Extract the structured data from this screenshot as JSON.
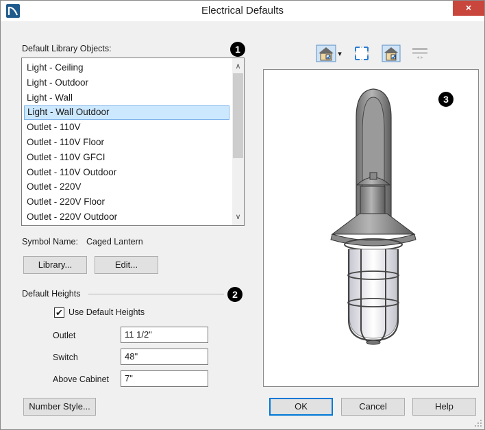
{
  "window": {
    "title": "Electrical Defaults",
    "close_label": "×",
    "app_icon": "chief-architect-logo-icon"
  },
  "library": {
    "label": "Default Library Objects:",
    "items": [
      "Light - Ceiling",
      "Light - Outdoor",
      "Light - Wall",
      "Light - Wall Outdoor",
      "Outlet - 110V",
      "Outlet - 110V Floor",
      "Outlet - 110V GFCI",
      "Outlet - 110V Outdoor",
      "Outlet - 220V",
      "Outlet - 220V Floor",
      "Outlet - 220V Outdoor"
    ],
    "selected_index": 3,
    "scroll_up": "∧",
    "scroll_down": "∨"
  },
  "symbol": {
    "label": "Symbol Name:",
    "value": "Caged Lantern"
  },
  "buttons": {
    "library": "Library...",
    "edit": "Edit...",
    "number_style": "Number Style...",
    "ok": "OK",
    "cancel": "Cancel",
    "help": "Help"
  },
  "heights": {
    "group_label": "Default Heights",
    "use_defaults_label": "Use Default Heights",
    "use_defaults_checked": true,
    "check_mark": "✔",
    "outlet_label": "Outlet",
    "outlet_value": "11 1/2\"",
    "switch_label": "Switch",
    "switch_value": "48\"",
    "above_cabinet_label": "Above Cabinet",
    "above_cabinet_value": "7\""
  },
  "badges": {
    "one": "1",
    "two": "2",
    "three": "3"
  },
  "toolbar": {
    "icons": [
      "camera-view-dropdown-icon",
      "fit-to-window-icon",
      "show-room-icon",
      "swap-disabled-icon"
    ],
    "dropdown_caret": "▾"
  },
  "colors": {
    "selection_bg": "#cce8ff",
    "selection_border": "#7eb4ea",
    "close_bg": "#c9463d",
    "accent": "#0078d7"
  }
}
